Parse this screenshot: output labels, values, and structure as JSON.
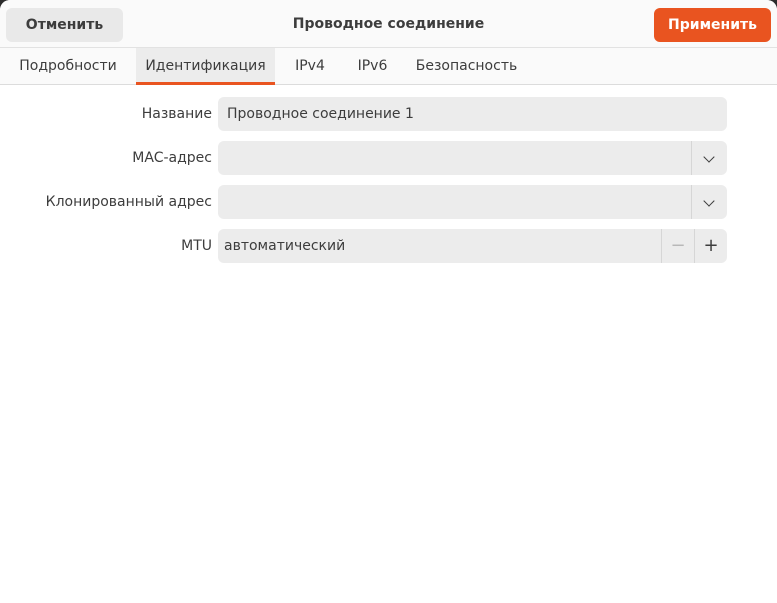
{
  "header": {
    "cancel_label": "Отменить",
    "title": "Проводное соединение",
    "apply_label": "Применить"
  },
  "tabs": [
    {
      "label": "Подробности",
      "active": false
    },
    {
      "label": "Идентификация",
      "active": true
    },
    {
      "label": "IPv4",
      "active": false
    },
    {
      "label": "IPv6",
      "active": false
    },
    {
      "label": "Безопасность",
      "active": false
    }
  ],
  "form": {
    "name_label": "Название",
    "name_value": "Проводное соединение 1",
    "mac_label": "MAC-адрес",
    "mac_value": "",
    "cloned_label": "Клонированный адрес",
    "cloned_value": "",
    "mtu_label": "MTU",
    "mtu_value": "автоматический",
    "mtu_minus": "−",
    "mtu_plus": "+"
  },
  "colors": {
    "accent": "#e95420"
  },
  "icons": {
    "dropdown": "chevron-down-icon",
    "decrement": "minus-icon",
    "increment": "plus-icon"
  }
}
